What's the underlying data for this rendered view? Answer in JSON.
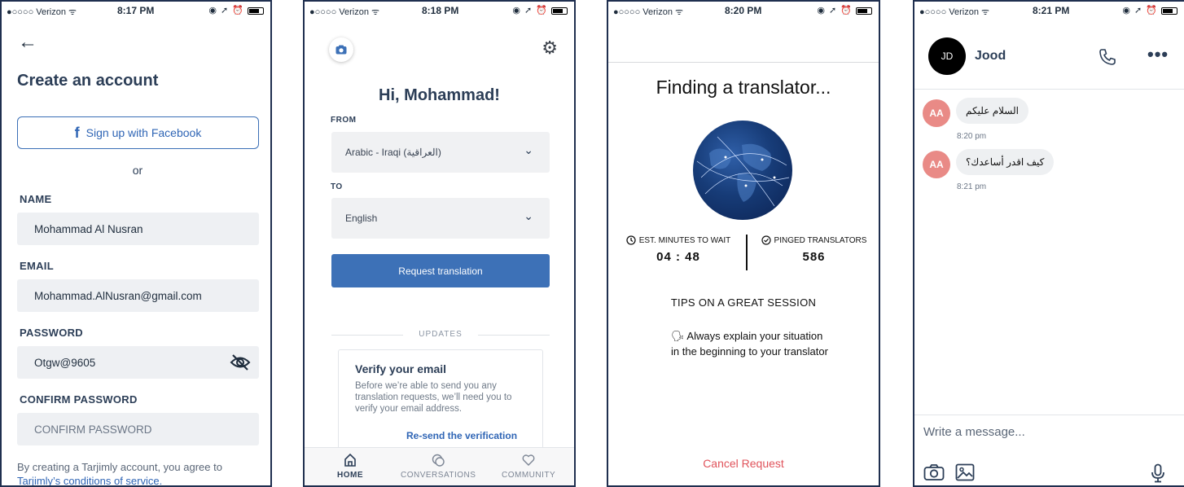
{
  "phones": [
    {
      "status": {
        "carrier": "●○○○○ Verizon ᯤ",
        "time": "8:17 PM",
        "icons": "◉ ➚ ⏰"
      },
      "back_label": "←",
      "title": "Create an account",
      "facebook_button": "Sign up with Facebook",
      "facebook_glyph": "f",
      "or": "or",
      "fields": {
        "name_label": "NAME",
        "name_value": "Mohammad Al Nusran",
        "email_label": "EMAIL",
        "email_value": "Mohammad.AlNusran@gmail.com",
        "password_label": "PASSWORD",
        "password_value": "Otgw@9605",
        "confirm_label": "CONFIRM PASSWORD",
        "confirm_placeholder": "CONFIRM PASSWORD"
      },
      "terms_text": "By creating a Tarjimly account, you agree to",
      "terms_link": "Tarjimly’s conditions of service."
    },
    {
      "status": {
        "carrier": "●○○○○ Verizon ᯤ",
        "time": "8:18 PM",
        "icons": "◉ ➚ ⏰"
      },
      "greeting": "Hi, Mohammad!",
      "from_label": "FROM",
      "from_value": "Arabic - Iraqi (العراقية)",
      "to_label": "TO",
      "to_value": "English",
      "request_button": "Request translation",
      "updates_label": "UPDATES",
      "card": {
        "title": "Verify your email",
        "body": "Before we’re able to send you any translation requests, we’ll need you to verify your email address.",
        "link": "Re-send the verification"
      },
      "tabs": [
        {
          "label": "HOME",
          "icon": "home-icon",
          "active": true
        },
        {
          "label": "CONVERSATIONS",
          "icon": "conversations-icon",
          "active": false
        },
        {
          "label": "COMMUNITY",
          "icon": "heart-icon",
          "active": false
        }
      ]
    },
    {
      "status": {
        "carrier": "●○○○○ Verizon ᯤ",
        "time": "8:20 PM",
        "icons": "◉ ➚ ⏰"
      },
      "heading": "Finding a translator...",
      "wait_label": "EST. MINUTES TO WAIT",
      "wait_value": "04 : 48",
      "pinged_label": "PINGED TRANSLATORS",
      "pinged_value": "586",
      "tips_heading": "TIPS ON A GREAT SESSION",
      "tip_icon": "🗣",
      "tip": "Always explain your situation in the beginning to your translator",
      "cancel": "Cancel Request"
    },
    {
      "status": {
        "carrier": "●○○○○ Verizon ᯤ",
        "time": "8:21 PM",
        "icons": "◉ ➚ ⏰"
      },
      "contact_initials": "JD",
      "contact_name": "Jood",
      "more_glyph": "•••",
      "messages": [
        {
          "avatar": "AA",
          "text": "السلام عليكم",
          "time": "8:20 pm"
        },
        {
          "avatar": "AA",
          "text": "كيف اقدر أساعدك؟",
          "time": "8:21 pm"
        }
      ],
      "compose_placeholder": "Write a message..."
    }
  ],
  "colors": {
    "accent": "#3d71b7",
    "link": "#2f65b5",
    "cancel": "#e0535b",
    "avatar": "#e98a86",
    "frame": "#1f2f4f"
  }
}
